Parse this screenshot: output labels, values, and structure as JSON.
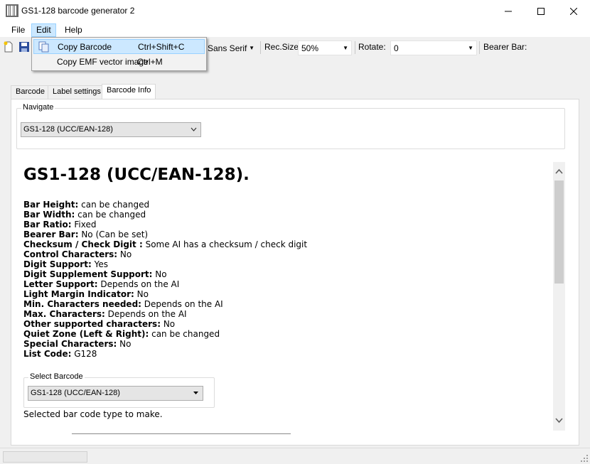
{
  "window": {
    "title": "GS1-128 barcode generator 2"
  },
  "menu": {
    "items": [
      "File",
      "Edit",
      "Help"
    ]
  },
  "edit_menu": {
    "items": [
      {
        "label": "Copy Barcode",
        "shortcut": "Ctrl+Shift+C",
        "icon": "copy-icon"
      },
      {
        "label": "Copy EMF vector image",
        "shortcut": "Ctrl+M"
      }
    ]
  },
  "toolbar": {
    "font_value": "Sans Serif",
    "recsize_label": "Rec.Size",
    "recsize_value": "50%",
    "rotate_label": "Rotate:",
    "rotate_value": "0",
    "bearer_label": "Bearer Bar:"
  },
  "tabs": [
    "Barcode",
    "Label settings",
    "Barcode Info"
  ],
  "navigate": {
    "label": "Navigate",
    "value": "GS1-128 (UCC/EAN-128)"
  },
  "info": {
    "heading": "GS1-128 (UCC/EAN-128).",
    "properties": [
      {
        "name": "Bar Height:",
        "value": " can be changed"
      },
      {
        "name": "Bar Width:",
        "value": " can be changed"
      },
      {
        "name": "Bar Ratio:",
        "value": " Fixed"
      },
      {
        "name": "Bearer Bar:",
        "value": " No (Can be set)"
      },
      {
        "name": "Checksum / Check Digit :",
        "value": " Some AI has a checksum / check digit"
      },
      {
        "name": "Control Characters:",
        "value": " No"
      },
      {
        "name": "Digit Support:",
        "value": " Yes"
      },
      {
        "name": "Digit Supplement Support:",
        "value": " No"
      },
      {
        "name": "Letter Support:",
        "value": " Depends on the AI"
      },
      {
        "name": "Light Margin Indicator:",
        "value": " No"
      },
      {
        "name": "Min. Characters needed:",
        "value": " Depends on the AI"
      },
      {
        "name": "Max. Characters:",
        "value": " Depends on the AI"
      },
      {
        "name": "Other supported characters:",
        "value": " No"
      },
      {
        "name": "Quiet Zone (Left & Right):",
        "value": " can be changed"
      },
      {
        "name": "Special Characters:",
        "value": " No"
      },
      {
        "name": "List Code:",
        "value": " G128"
      }
    ],
    "select_label": "Select Barcode",
    "select_value": "GS1-128 (UCC/EAN-128)",
    "select_hint": "Selected bar code type to make."
  },
  "colors": {
    "menu_highlight": "#cce8ff",
    "menu_highlight_border": "#99d1ff",
    "window_bg": "#f0f0f0"
  }
}
